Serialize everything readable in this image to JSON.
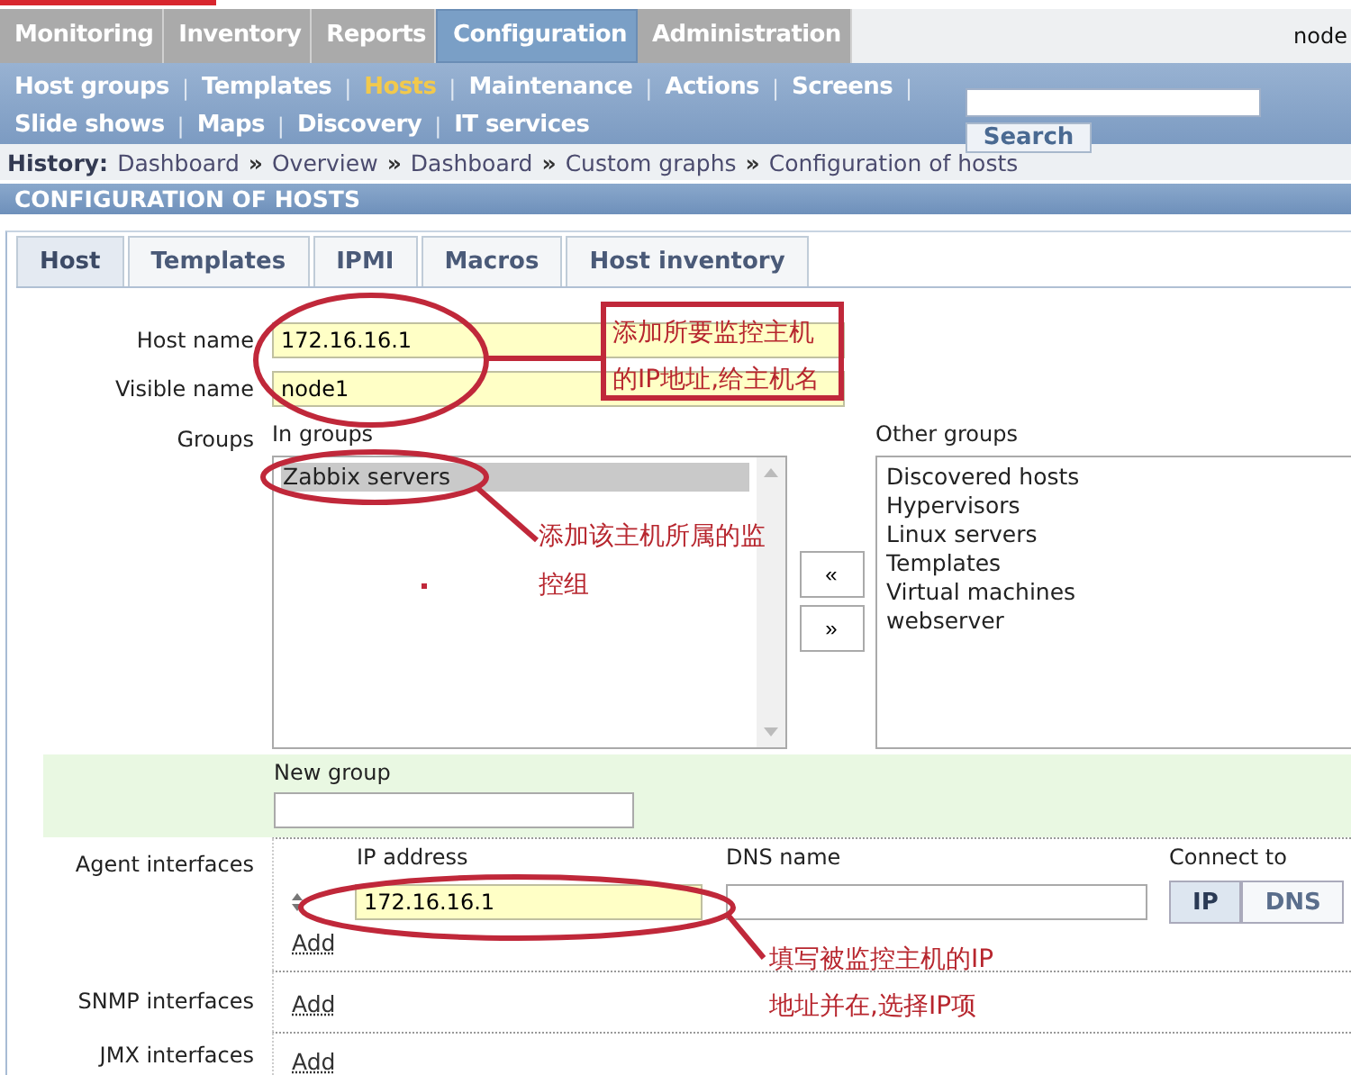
{
  "top_nav": {
    "tabs": [
      {
        "label": "Monitoring",
        "selected": false
      },
      {
        "label": "Inventory",
        "selected": false
      },
      {
        "label": "Reports",
        "selected": false
      },
      {
        "label": "Configuration",
        "selected": true
      },
      {
        "label": "Administration",
        "selected": false
      }
    ],
    "user": "node"
  },
  "sub_nav": {
    "link_lines": [
      [
        {
          "kind": "link",
          "label": "Host groups",
          "selected": false
        },
        {
          "kind": "separator",
          "label": "|"
        },
        {
          "kind": "link",
          "label": "Templates",
          "selected": false
        },
        {
          "kind": "separator",
          "label": "|"
        },
        {
          "kind": "link",
          "label": "Hosts",
          "selected": true
        },
        {
          "kind": "separator",
          "label": "|"
        },
        {
          "kind": "link",
          "label": "Maintenance",
          "selected": false
        },
        {
          "kind": "separator",
          "label": "|"
        },
        {
          "kind": "link",
          "label": "Actions",
          "selected": false
        },
        {
          "kind": "separator",
          "label": "|"
        },
        {
          "kind": "link",
          "label": "Screens",
          "selected": false
        },
        {
          "kind": "separator",
          "label": "|"
        }
      ],
      [
        {
          "kind": "link",
          "label": "Slide shows",
          "selected": false
        },
        {
          "kind": "separator",
          "label": "|"
        },
        {
          "kind": "link",
          "label": "Maps",
          "selected": false
        },
        {
          "kind": "separator",
          "label": "|"
        },
        {
          "kind": "link",
          "label": "Discovery",
          "selected": false
        },
        {
          "kind": "separator",
          "label": "|"
        },
        {
          "kind": "link",
          "label": "IT services",
          "selected": false
        }
      ]
    ],
    "search_button": "Search"
  },
  "history": {
    "label": "History:",
    "items": [
      {
        "kind": "link",
        "text": "Dashboard"
      },
      {
        "kind": "separator",
        "text": "»"
      },
      {
        "kind": "link",
        "text": "Overview"
      },
      {
        "kind": "separator",
        "text": "»"
      },
      {
        "kind": "link",
        "text": "Dashboard"
      },
      {
        "kind": "separator",
        "text": "»"
      },
      {
        "kind": "link",
        "text": "Custom graphs"
      },
      {
        "kind": "separator",
        "text": "»"
      },
      {
        "kind": "link",
        "text": "Configuration of hosts"
      }
    ]
  },
  "page_header": "CONFIGURATION OF HOSTS",
  "form_tabs": [
    {
      "label": "Host",
      "selected": true
    },
    {
      "label": "Templates",
      "selected": false
    },
    {
      "label": "IPMI",
      "selected": false
    },
    {
      "label": "Macros",
      "selected": false
    },
    {
      "label": "Host inventory",
      "selected": false
    }
  ],
  "form": {
    "host_name": {
      "label": "Host name",
      "value": "172.16.16.1"
    },
    "visible_name": {
      "label": "Visible name",
      "value": "node1"
    },
    "groups": {
      "label": "Groups",
      "in_groups_label": "In groups",
      "in_groups": [
        {
          "label": "Zabbix servers",
          "selected": true
        }
      ],
      "move_buttons": [
        "«",
        "»"
      ],
      "other_groups_label": "Other groups",
      "other_groups": [
        {
          "label": "Discovered hosts",
          "selected": false
        },
        {
          "label": "Hypervisors",
          "selected": false
        },
        {
          "label": "Linux servers",
          "selected": false
        },
        {
          "label": "Templates",
          "selected": false
        },
        {
          "label": "Virtual machines",
          "selected": false
        },
        {
          "label": "webserver",
          "selected": false
        }
      ]
    },
    "new_group": {
      "label": "New group"
    },
    "agent_interfaces": {
      "label": "Agent interfaces",
      "columns": [
        "IP address",
        "DNS name",
        "Connect to"
      ],
      "ip_value": "172.16.16.1",
      "connect_buttons": [
        {
          "label": "IP",
          "selected": true
        },
        {
          "label": "DNS",
          "selected": false
        }
      ],
      "add": "Add"
    },
    "snmp_interfaces": {
      "label": "SNMP interfaces",
      "add": "Add"
    },
    "jmx_interfaces": {
      "label": "JMX interfaces",
      "add": "Add"
    }
  },
  "annotations": {
    "host_note": [
      "添加所要监控主机",
      "的IP地址,给主机名"
    ],
    "group_note": [
      "添加该主机所属的监",
      "控组"
    ],
    "interface_note": [
      "填写被监控主机的IP",
      "地址并在,选择IP项"
    ]
  }
}
